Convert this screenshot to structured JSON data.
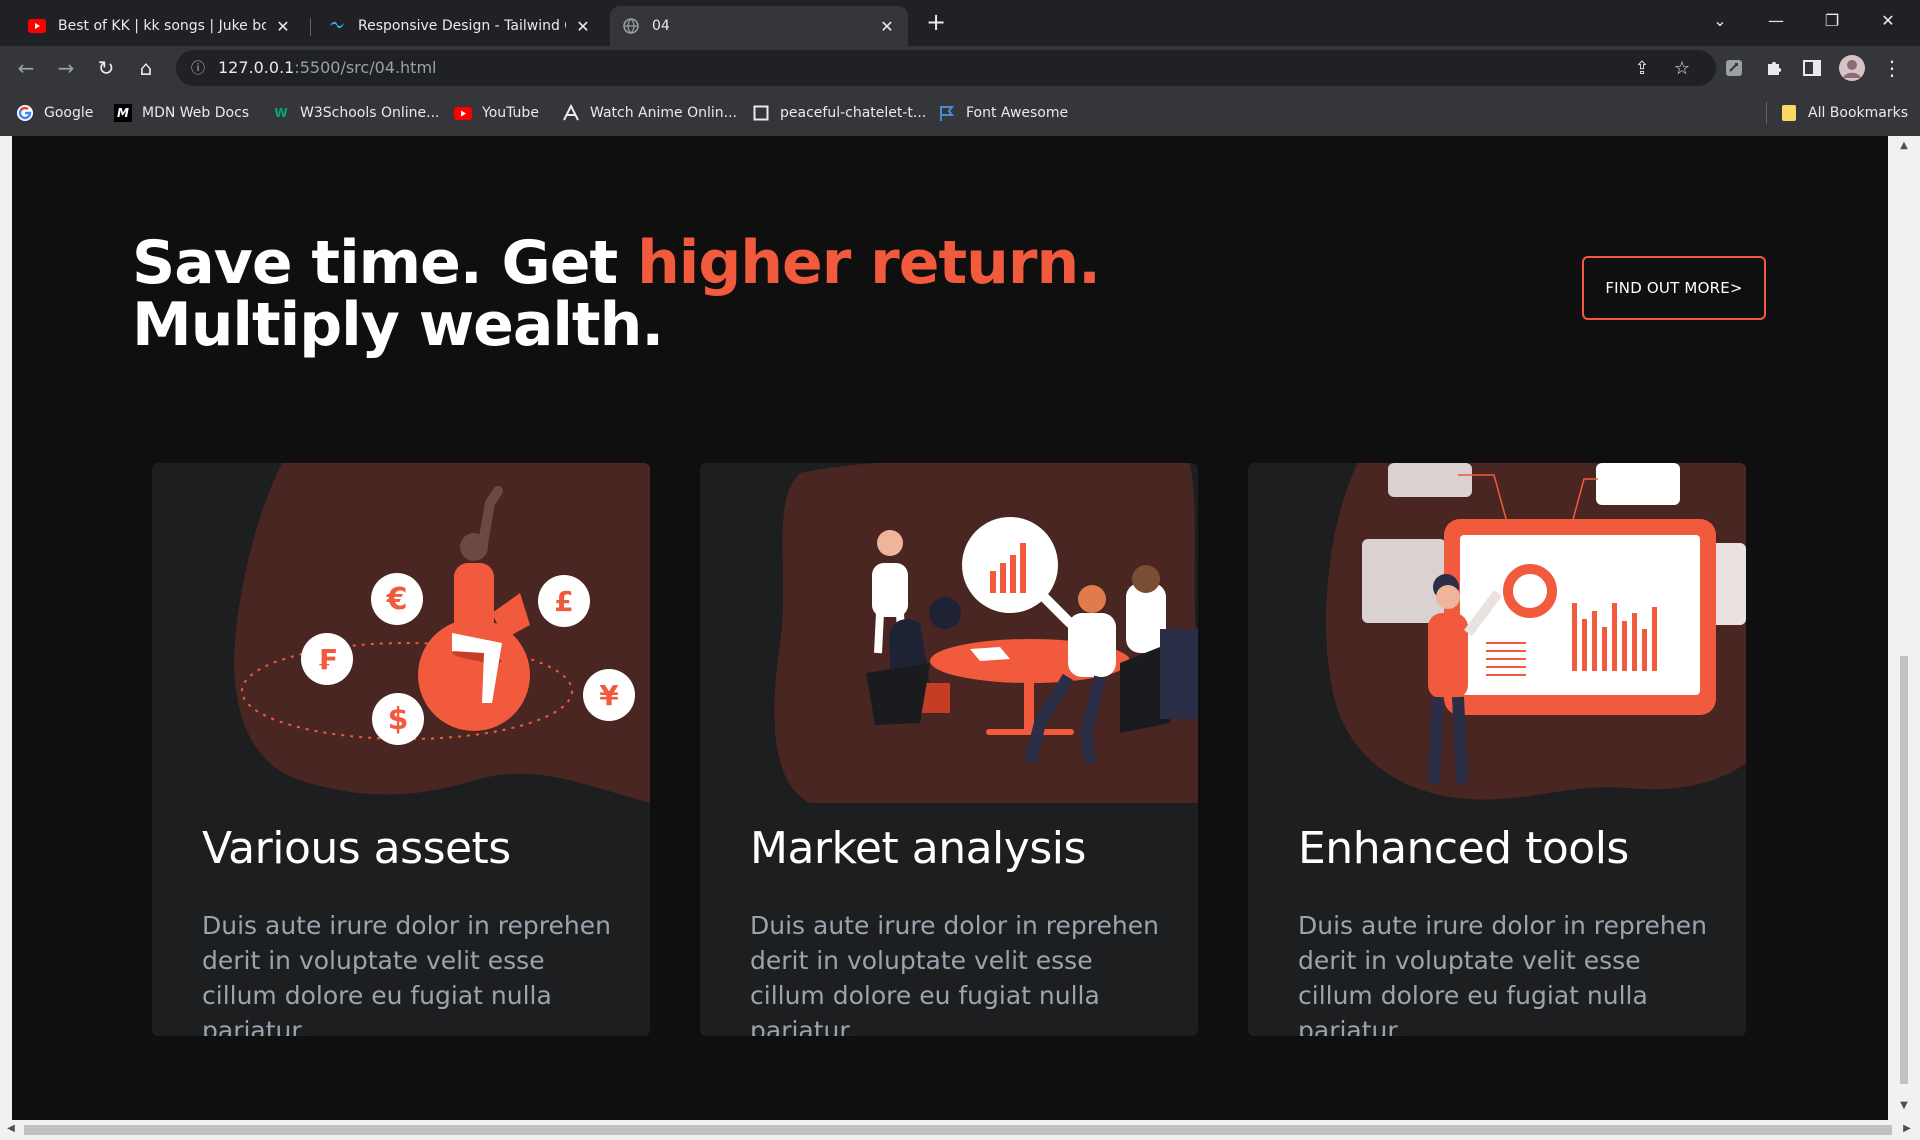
{
  "browser": {
    "tabs": [
      {
        "title": "Best of KK | kk songs | Juke box |",
        "icon": "youtube-icon",
        "active": false
      },
      {
        "title": "Responsive Design - Tailwind CSS",
        "icon": "tailwind-icon",
        "active": false
      },
      {
        "title": "04",
        "icon": "globe-icon",
        "active": true
      }
    ],
    "url_host": "127.0.0.1",
    "url_path": ":5500/src/04.html",
    "bookmarks": [
      {
        "label": "Google",
        "icon": "google-icon"
      },
      {
        "label": "MDN Web Docs",
        "icon": "mdn-icon"
      },
      {
        "label": "W3Schools Online...",
        "icon": "w3schools-icon"
      },
      {
        "label": "YouTube",
        "icon": "youtube-icon"
      },
      {
        "label": "Watch Anime Onlin...",
        "icon": "anime-icon"
      },
      {
        "label": "peaceful-chatelet-t...",
        "icon": "page-icon"
      },
      {
        "label": "Font Awesome",
        "icon": "flag-icon"
      }
    ],
    "all_bookmarks": "All Bookmarks"
  },
  "hero": {
    "title_part1": "Save time. Get ",
    "title_accent": "higher return.",
    "title_part2": "Multiply wealth.",
    "cta": "FIND OUT MORE>"
  },
  "cards": [
    {
      "title": "Various assets",
      "text": "Duis aute irure dolor in reprehen derit in voluptate velit esse cillum dolore eu fugiat nulla pariatur."
    },
    {
      "title": "Market analysis",
      "text": "Duis aute irure dolor in reprehen derit in voluptate velit esse cillum dolore eu fugiat nulla pariatur."
    },
    {
      "title": "Enhanced tools",
      "text": "Duis aute irure dolor in reprehen derit in voluptate velit esse cillum dolore eu fugiat nulla pariatur."
    }
  ],
  "colors": {
    "accent": "#f15a3c",
    "background": "#0f0f10",
    "card": "#1d1e20",
    "blob": "#4a2622"
  }
}
